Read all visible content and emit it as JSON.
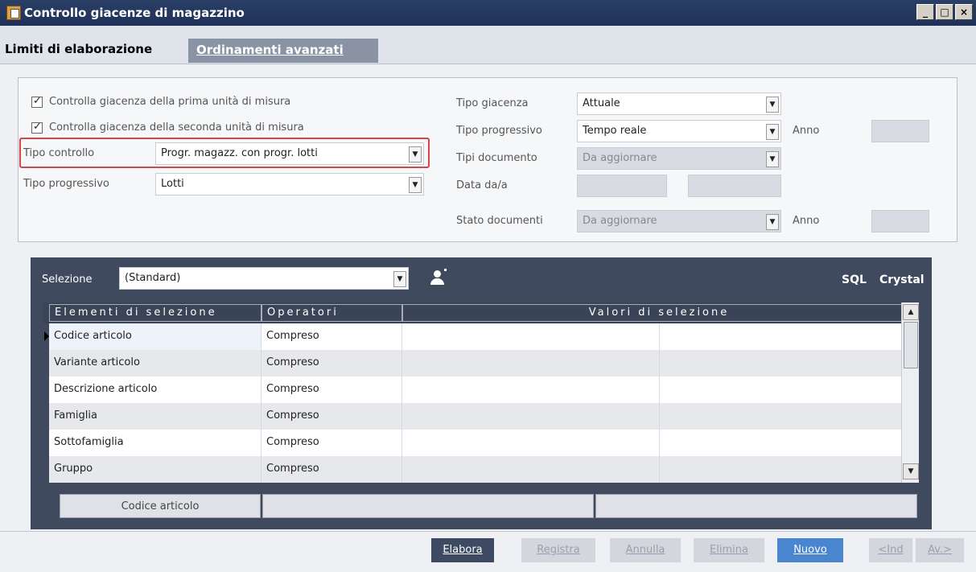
{
  "window": {
    "title": "Controllo giacenze di magazzino",
    "minimize": "_",
    "maximize": "□",
    "close": "×"
  },
  "tabs": {
    "active": "Limiti di elaborazione",
    "inactive": "Ordinamenti avanzati"
  },
  "limits": {
    "check1": "Controlla giacenza della prima unità di misura",
    "check2": "Controlla giacenza della seconda unità di misura",
    "tipo_controllo_label": "Tipo controllo",
    "tipo_controllo_value": "Progr. magazz. con progr. lotti",
    "tipo_progressivo_label": "Tipo progressivo",
    "tipo_progressivo_value": "Lotti",
    "tipo_giacenza_label": "Tipo giacenza",
    "tipo_giacenza_value": "Attuale",
    "tipo_progressivo2_label": "Tipo progressivo",
    "tipo_progressivo2_value": "Tempo reale",
    "anno1_label": "Anno",
    "tipi_documento_label": "Tipi documento",
    "tipi_documento_value": "Da aggiornare",
    "data_da_a_label": "Data da/a",
    "stato_documenti_label": "Stato documenti",
    "stato_documenti_value": "Da aggiornare",
    "anno2_label": "Anno"
  },
  "selection": {
    "label": "Selezione",
    "value": "(Standard)",
    "sql": "SQL",
    "crystal": "Crystal",
    "headers": [
      "Elementi di selezione",
      "Operatori",
      "Valori di selezione"
    ],
    "rows": [
      {
        "elemento": "Codice articolo",
        "operatore": "Compreso"
      },
      {
        "elemento": "Variante articolo",
        "operatore": "Compreso"
      },
      {
        "elemento": "Descrizione articolo",
        "operatore": "Compreso"
      },
      {
        "elemento": "Famiglia",
        "operatore": "Compreso"
      },
      {
        "elemento": "Sottofamiglia",
        "operatore": "Compreso"
      },
      {
        "elemento": "Gruppo",
        "operatore": "Compreso"
      }
    ],
    "detail_label": "Codice articolo"
  },
  "footer": {
    "elabora": "Elabora",
    "registra": "Registra",
    "annulla": "Annulla",
    "elimina": "Elimina",
    "nuovo": "Nuovo",
    "ind": "<Ind",
    "av": "Av.>"
  }
}
